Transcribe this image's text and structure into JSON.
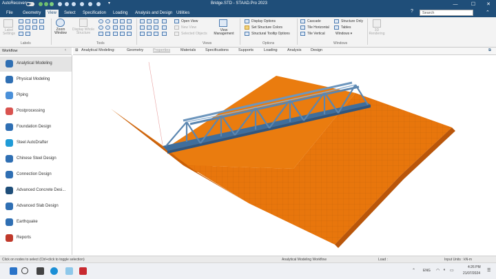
{
  "titlebar": {
    "autorecovery_label": "AutoRecovery",
    "autorecovery_state": "Off",
    "title": "Bridge.STD - STAAD.Pro 2023",
    "help": "?",
    "minimize": "—",
    "maximize": "☐",
    "close": "✕"
  },
  "menu": {
    "tabs": [
      "File",
      "Geometry",
      "View",
      "Select",
      "Specification",
      "Loading",
      "Analysis and Design",
      "Utilities"
    ],
    "active_tab": "View",
    "search_placeholder": "Search"
  },
  "ribbon": {
    "labels_group": {
      "label_settings": "Label Settings",
      "group": "Labels"
    },
    "tools_group": {
      "zoom_window": "Zoom Window",
      "display_whole_structure": "Display Whole Structure",
      "group": "Tools"
    },
    "views_group": {
      "open_view": "Open View",
      "new_view": "New View",
      "selected_objects": "Selected Objects",
      "view_management": "View Management",
      "group": "Views"
    },
    "options_group": {
      "display_options": "Display Options",
      "set_structure_colors": "Set Structure Colors",
      "structural_tooltip_options": "Structural Tooltip Options",
      "group": "Options"
    },
    "windows_group": {
      "cascade": "Cascade",
      "tile_horizontal": "Tile Horizontal",
      "tile_vertical": "Tile Vertical",
      "structure_only": "Structure Only",
      "tables": "Tables",
      "windows": "Windows",
      "group": "Windows"
    },
    "rendering": "3D Rendering"
  },
  "workflow": {
    "header": "Workflow",
    "items": [
      {
        "label": "Analytical Modeling",
        "color": "#2f6fb3"
      },
      {
        "label": "Physical Modeling",
        "color": "#2f6fb3"
      },
      {
        "label": "Piping",
        "color": "#4a90d9"
      },
      {
        "label": "Postprocessing",
        "color": "#d9534f"
      },
      {
        "label": "Foundation Design",
        "color": "#2f6fb3"
      },
      {
        "label": "Steel AutoDrafter",
        "color": "#1f9bd7"
      },
      {
        "label": "Chinese Steel Design",
        "color": "#2f6fb3"
      },
      {
        "label": "Connection Design",
        "color": "#2f6fb3"
      },
      {
        "label": "Advanced Concrete Desi...",
        "color": "#1f4e79"
      },
      {
        "label": "Advanced Slab Design",
        "color": "#2f6fb3"
      },
      {
        "label": "Earthquake",
        "color": "#2f6fb3"
      },
      {
        "label": "Reports",
        "color": "#c0392b"
      }
    ]
  },
  "viewport_tabs": {
    "current": "Analytical Modeling:",
    "items": [
      "Geometry",
      "Properties",
      "Materials",
      "Specifications",
      "Supports",
      "Loading",
      "Analysis",
      "Design"
    ],
    "faded": "Properties"
  },
  "colors": {
    "accent": "#1f4e79",
    "terrain": "#e8760c",
    "truss": "#5b86b0"
  },
  "status": {
    "hint": "Click on nodes to select (Ctrl+click to toggle selection)",
    "workflow": "Analytical Modeling Workflow",
    "load": "Load :",
    "units": "Input Units : kN-m"
  },
  "taskbar": {
    "lang": "ENG",
    "time": "4:26 PM",
    "date": "21/07/2024"
  }
}
